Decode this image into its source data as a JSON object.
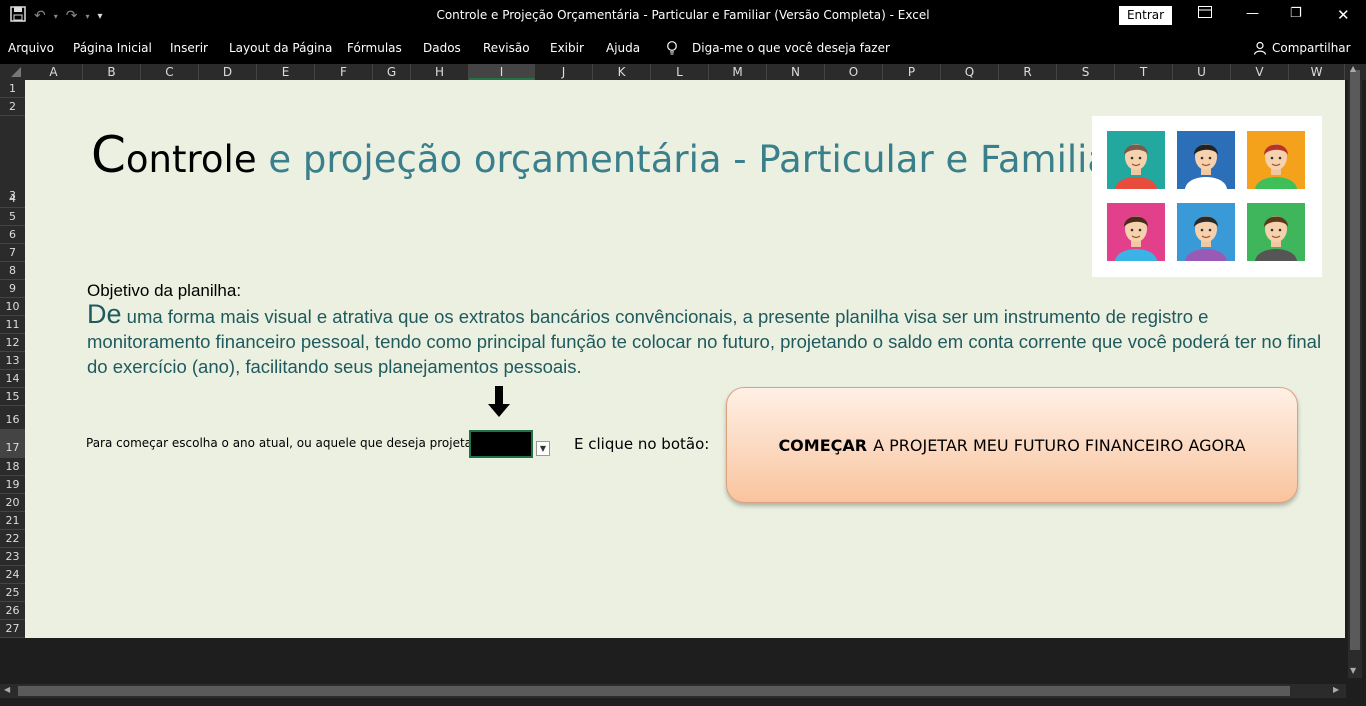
{
  "window": {
    "title": "Controle e Projeção Orçamentária - Particular e Familiar (Versão Completa)  -  Excel",
    "signin_label": "Entrar"
  },
  "ribbon_tabs": [
    "Arquivo",
    "Página Inicial",
    "Inserir",
    "Layout da Página",
    "Fórmulas",
    "Dados",
    "Revisão",
    "Exibir",
    "Ajuda"
  ],
  "tell_me": "Diga-me o que você deseja fazer",
  "share_label": "Compartilhar",
  "columns": [
    "A",
    "B",
    "C",
    "D",
    "E",
    "F",
    "G",
    "H",
    "I",
    "J",
    "K",
    "L",
    "M",
    "N",
    "O",
    "P",
    "Q",
    "R",
    "S",
    "T",
    "U",
    "V",
    "W"
  ],
  "selected_column": "I",
  "rows": [
    "1",
    "2",
    "3",
    "4",
    "5",
    "6",
    "7",
    "8",
    "9",
    "10",
    "11",
    "12",
    "13",
    "14",
    "15",
    "16",
    "17",
    "18",
    "19",
    "20",
    "21",
    "22",
    "23",
    "24",
    "25",
    "26",
    "27"
  ],
  "sheet": {
    "title_first_letter": "C",
    "title_dark": "ontrole",
    "title_teal": " e projeção orçamentária - Particular e Familiar",
    "objective_label": "Objetivo da planilha:",
    "objective_dropcap": "De",
    "objective_text": " uma forma mais visual e atrativa que os extratos bancários convêncionais, a presente planilha visa ser um instrumento de registro e monitoramento financeiro pessoal, tendo como principal função te colocar no futuro, projetando o saldo em conta corrente que você poderá ter no final do exercício (ano), facilitando seus planejamentos pessoais.",
    "year_prompt": "Para começar escolha o ano atual, ou aquele que deseja projetar:",
    "click_prompt": "E clique no botão:",
    "start_button_bold": "COMEÇAR",
    "start_button_rest": "A PROJETAR MEU FUTURO FINANCEIRO AGORA"
  },
  "avatars": [
    {
      "bg": "#23a8a0",
      "shirt": "#e84c3d",
      "hair": "#7a5a4a"
    },
    {
      "bg": "#2a6fb8",
      "shirt": "#ffffff",
      "hair": "#222222"
    },
    {
      "bg": "#f4a21c",
      "shirt": "#3fbf5a",
      "hair": "#b8342b"
    },
    {
      "bg": "#e2408a",
      "shirt": "#3ab3e6",
      "hair": "#4a2a1a"
    },
    {
      "bg": "#3a9ad8",
      "shirt": "#9b59b6",
      "hair": "#2a2a2a"
    },
    {
      "bg": "#3fb55c",
      "shirt": "#555555",
      "hair": "#5a3a1a"
    }
  ]
}
